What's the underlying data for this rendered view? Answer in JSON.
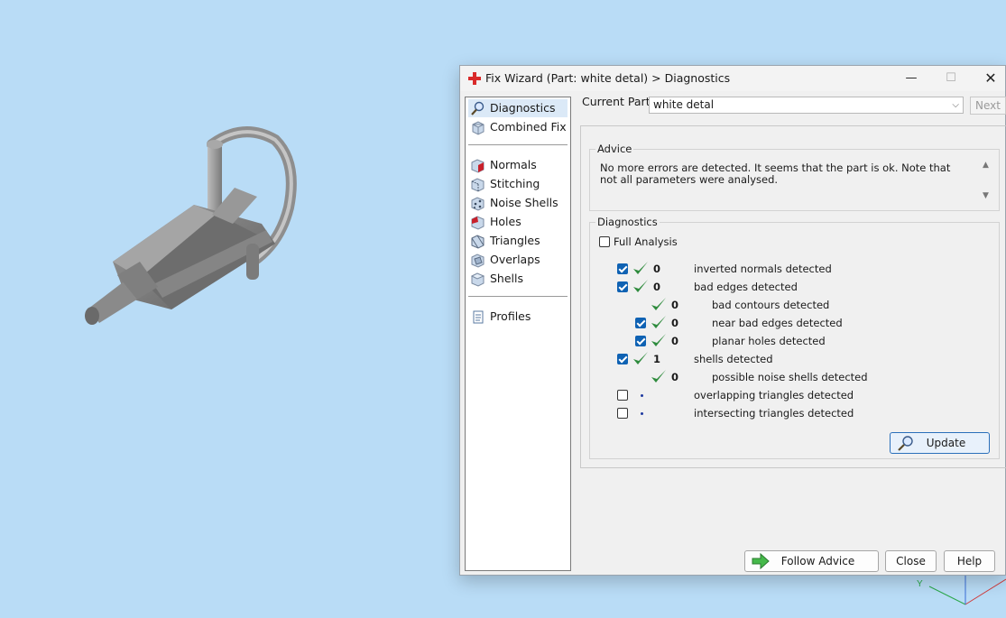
{
  "window": {
    "title": "Fix Wizard (Part: white detal) > Diagnostics",
    "minimize": "—",
    "maximize": "☐",
    "close": "✕"
  },
  "sidebar": {
    "items": [
      {
        "label": "Diagnostics",
        "icon": "magnifier-icon"
      },
      {
        "label": "Combined Fix",
        "icon": "cube-icon"
      },
      {
        "label": "Normals",
        "icon": "normals-cube-icon"
      },
      {
        "label": "Stitching",
        "icon": "stitching-cube-icon"
      },
      {
        "label": "Noise Shells",
        "icon": "noise-shells-icon"
      },
      {
        "label": "Holes",
        "icon": "holes-cube-icon"
      },
      {
        "label": "Triangles",
        "icon": "triangles-cube-icon"
      },
      {
        "label": "Overlaps",
        "icon": "overlaps-cube-icon"
      },
      {
        "label": "Shells",
        "icon": "shells-cube-icon"
      },
      {
        "label": "Profiles",
        "icon": "document-icon"
      }
    ]
  },
  "current_part": {
    "label": "Current Part:",
    "value": "white detal",
    "next": "Next"
  },
  "advice": {
    "title": "Advice",
    "text": "No more errors are detected. It seems that the part is ok. Note that not all parameters were analysed."
  },
  "diagnostics": {
    "title": "Diagnostics",
    "full_analysis": "Full Analysis",
    "rows": [
      {
        "checked": true,
        "status": "ok",
        "count": "0",
        "label": "inverted normals detected"
      },
      {
        "checked": true,
        "status": "ok",
        "count": "0",
        "label": "bad edges detected"
      },
      {
        "checked": null,
        "status": "ok",
        "count": "0",
        "label": "bad contours detected"
      },
      {
        "checked": true,
        "status": "ok",
        "count": "0",
        "label": "near bad edges detected"
      },
      {
        "checked": true,
        "status": "ok",
        "count": "0",
        "label": "planar holes detected"
      },
      {
        "checked": true,
        "status": "ok",
        "count": "1",
        "label": "shells detected"
      },
      {
        "checked": null,
        "status": "ok",
        "count": "0",
        "label": "possible noise shells detected"
      },
      {
        "checked": false,
        "status": "none",
        "count": "",
        "label": "overlapping triangles detected"
      },
      {
        "checked": false,
        "status": "none",
        "count": "",
        "label": "intersecting triangles detected"
      }
    ],
    "update": "Update"
  },
  "footer": {
    "follow_advice": "Follow Advice",
    "close": "Close",
    "help": "Help"
  },
  "colors": {
    "background": "#b9dcf6",
    "check_green": "#2e8b3d",
    "checkbox_blue": "#0f62b3"
  }
}
